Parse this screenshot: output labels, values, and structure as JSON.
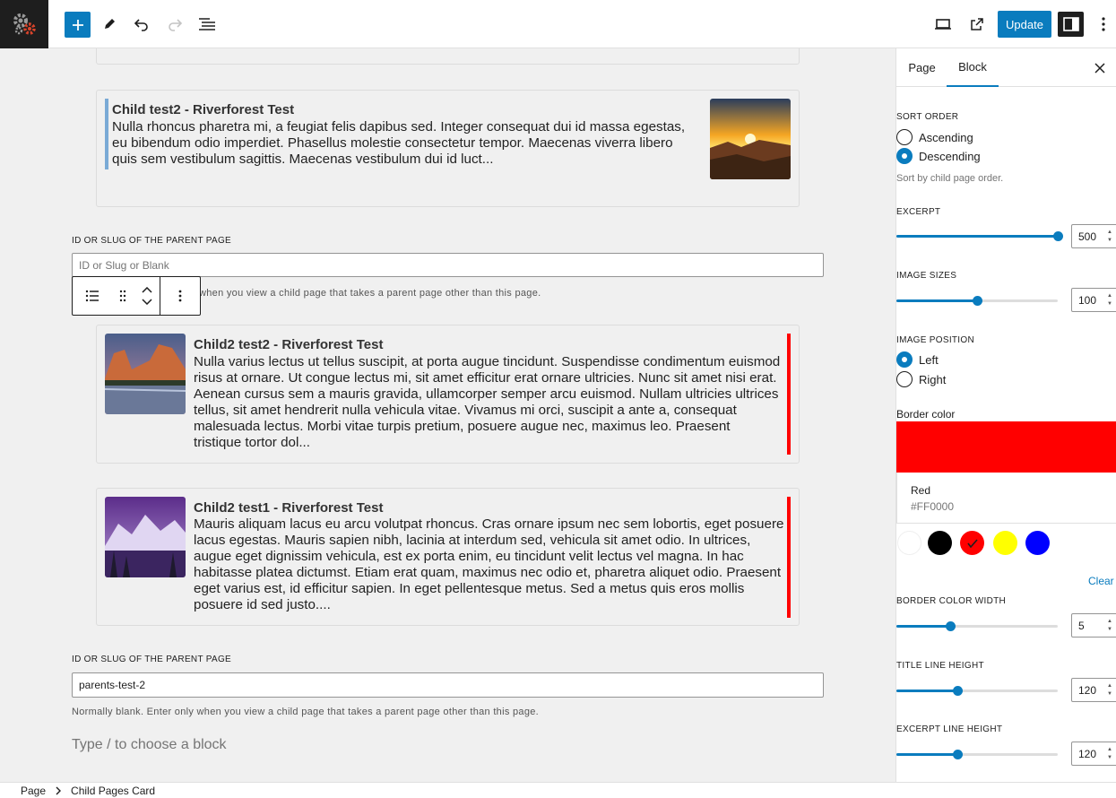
{
  "toolbar": {
    "update_label": "Update",
    "icons": [
      "add-block-icon",
      "pencil-icon",
      "undo-icon",
      "redo-icon",
      "list-view-icon",
      "desktop-view-icon",
      "external-link-icon",
      "sidebar-icon",
      "more-vertical-icon"
    ]
  },
  "canvas": {
    "cards": [
      {
        "title": "Child test2 - Riverforest Test",
        "excerpt": "Nulla rhoncus pharetra mi, a feugiat felis dapibus sed. Integer consequat dui id massa egestas, eu bibendum odio imperdiet. Phasellus molestie consectetur tempor. Maecenas viverra libero quis sem vestibulum sagittis. Maecenas vestibulum dui id luct...",
        "image": "sunset-mountains"
      },
      {
        "title": "Child2 test2 - Riverforest Test",
        "excerpt": "Nulla varius lectus ut tellus suscipit, at porta augue tincidunt. Suspendisse condimentum euismod risus at ornare. Ut congue lectus mi, sit amet efficitur erat ornare ultricies. Nunc sit amet nisi erat. Aenean cursus sem a mauris gravida, ullamcorper semper arcu euismod. Nullam ultricies ultrices tellus, sit amet hendrerit nulla vehicula vitae. Vivamus mi orci, suscipit a ante a, consequat malesuada lectus. Morbi vitae turpis pretium, posuere augue nec, maximus leo. Praesent tristique tortor dol...",
        "image": "yosemite-lake"
      },
      {
        "title": "Child2 test1 - Riverforest Test",
        "excerpt": "Mauris aliquam lacus eu arcu volutpat rhoncus. Cras ornare ipsum nec sem lobortis, eget posuere lacus egestas. Mauris sapien nibh, lacinia at interdum sed, vehicula sit amet odio. In ultrices, augue eget dignissim vehicula, est ex porta enim, eu tincidunt velit lectus vel magna. In hac habitasse platea dictumst. Etiam erat quam, maximus nec odio et, pharetra aliquet odio. Praesent eget varius est, id efficitur sapien. In eget pellentesque metus. Sed a metus quis eros mollis posuere id sed justo....",
        "image": "purple-mountains"
      }
    ],
    "field1": {
      "label": "ID OR SLUG OF THE PARENT PAGE",
      "placeholder": "ID or Slug or Blank",
      "value": "",
      "help_partial": "when you view a child page that takes a parent page other than this page."
    },
    "field2": {
      "label": "ID OR SLUG OF THE PARENT PAGE",
      "value": "parents-test-2",
      "help": "Normally blank. Enter only when you view a child page that takes a parent page other than this page."
    },
    "appender": "Type / to choose a block"
  },
  "footer": {
    "crumbs": [
      "Page",
      "Child Pages Card"
    ]
  },
  "sidebar": {
    "tabs": [
      "Page",
      "Block"
    ],
    "active_tab": "Block",
    "sort_order": {
      "label": "SORT ORDER",
      "options": [
        "Ascending",
        "Descending"
      ],
      "selected": "Descending",
      "help": "Sort by child page order."
    },
    "excerpt": {
      "label": "EXCERPT",
      "value": "500",
      "fraction": 1.0
    },
    "image_sizes": {
      "label": "IMAGE SIZES",
      "value": "100",
      "fraction": 0.5
    },
    "image_position": {
      "label": "IMAGE POSITION",
      "options": [
        "Left",
        "Right"
      ],
      "selected": "Left"
    },
    "border_color": {
      "label": "Border color",
      "name": "Red",
      "hex": "#FF0000",
      "palette": [
        "#ffffff",
        "#000000",
        "#ff0000",
        "#ffff00",
        "#0000ff"
      ],
      "clear_label": "Clear"
    },
    "border_color_width": {
      "label": "BORDER COLOR WIDTH",
      "value": "5",
      "fraction": 0.33
    },
    "title_line_height": {
      "label": "TITLE LINE HEIGHT",
      "value": "120",
      "fraction": 0.38
    },
    "excerpt_line_height": {
      "label": "EXCERPT LINE HEIGHT",
      "value": "120",
      "fraction": 0.38
    }
  }
}
